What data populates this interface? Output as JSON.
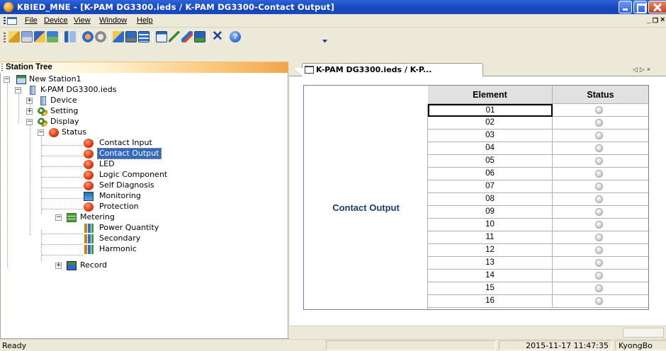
{
  "window": {
    "title": "KBIED_MNE - [K-PAM DG3300.ieds / K-PAM DG3300-Contact Output]"
  },
  "menu": {
    "file": "File",
    "device": "Device",
    "view": "View",
    "window": "Window",
    "help": "Help"
  },
  "toolbar": {
    "icons": [
      "open-icon",
      "save-icon",
      "save-all-icon",
      "save-as-icon",
      "connect-icon",
      "send-icon",
      "receive-icon",
      "compare-icon",
      "monitor-icon",
      "table-icon",
      "window-icon",
      "wire-icon",
      "wire-alt-icon",
      "export-icon",
      "close-x-icon",
      "help-icon"
    ]
  },
  "station_tree": {
    "title": "Station Tree",
    "nodes": {
      "station": "New Station1",
      "ied": "K-PAM DG3300.ieds",
      "device": "Device",
      "setting": "Setting",
      "display": "Display",
      "status": "Status",
      "contact_input": "Contact Input",
      "contact_output": "Contact Output",
      "led": "LED",
      "logic_component": "Logic Component",
      "self_diagnosis": "Self Diagnosis",
      "monitoring": "Monitoring",
      "protection": "Protection",
      "metering": "Metering",
      "power_quantity": "Power Quantity",
      "secondary": "Secondary",
      "harmonic": "Harmonic",
      "record": "Record"
    },
    "selected": "Contact Output"
  },
  "tab": {
    "label": "K-PAM DG3300.ieds / K-P..."
  },
  "grid": {
    "col_element": "Element",
    "col_status": "Status",
    "group": "Contact Output",
    "rows": [
      "01",
      "02",
      "03",
      "04",
      "05",
      "06",
      "07",
      "08",
      "09",
      "10",
      "11",
      "12",
      "13",
      "14",
      "15",
      "16"
    ],
    "status_color": "#c8c8c8"
  },
  "statusbar": {
    "ready": "Ready",
    "datetime": "2015-11-17 11:47:35",
    "user": "KyongBo"
  },
  "colors": {
    "titlebar": "#1d4fc4",
    "selection": "#316ac5",
    "header_gradient_end": "#f2a54a"
  }
}
